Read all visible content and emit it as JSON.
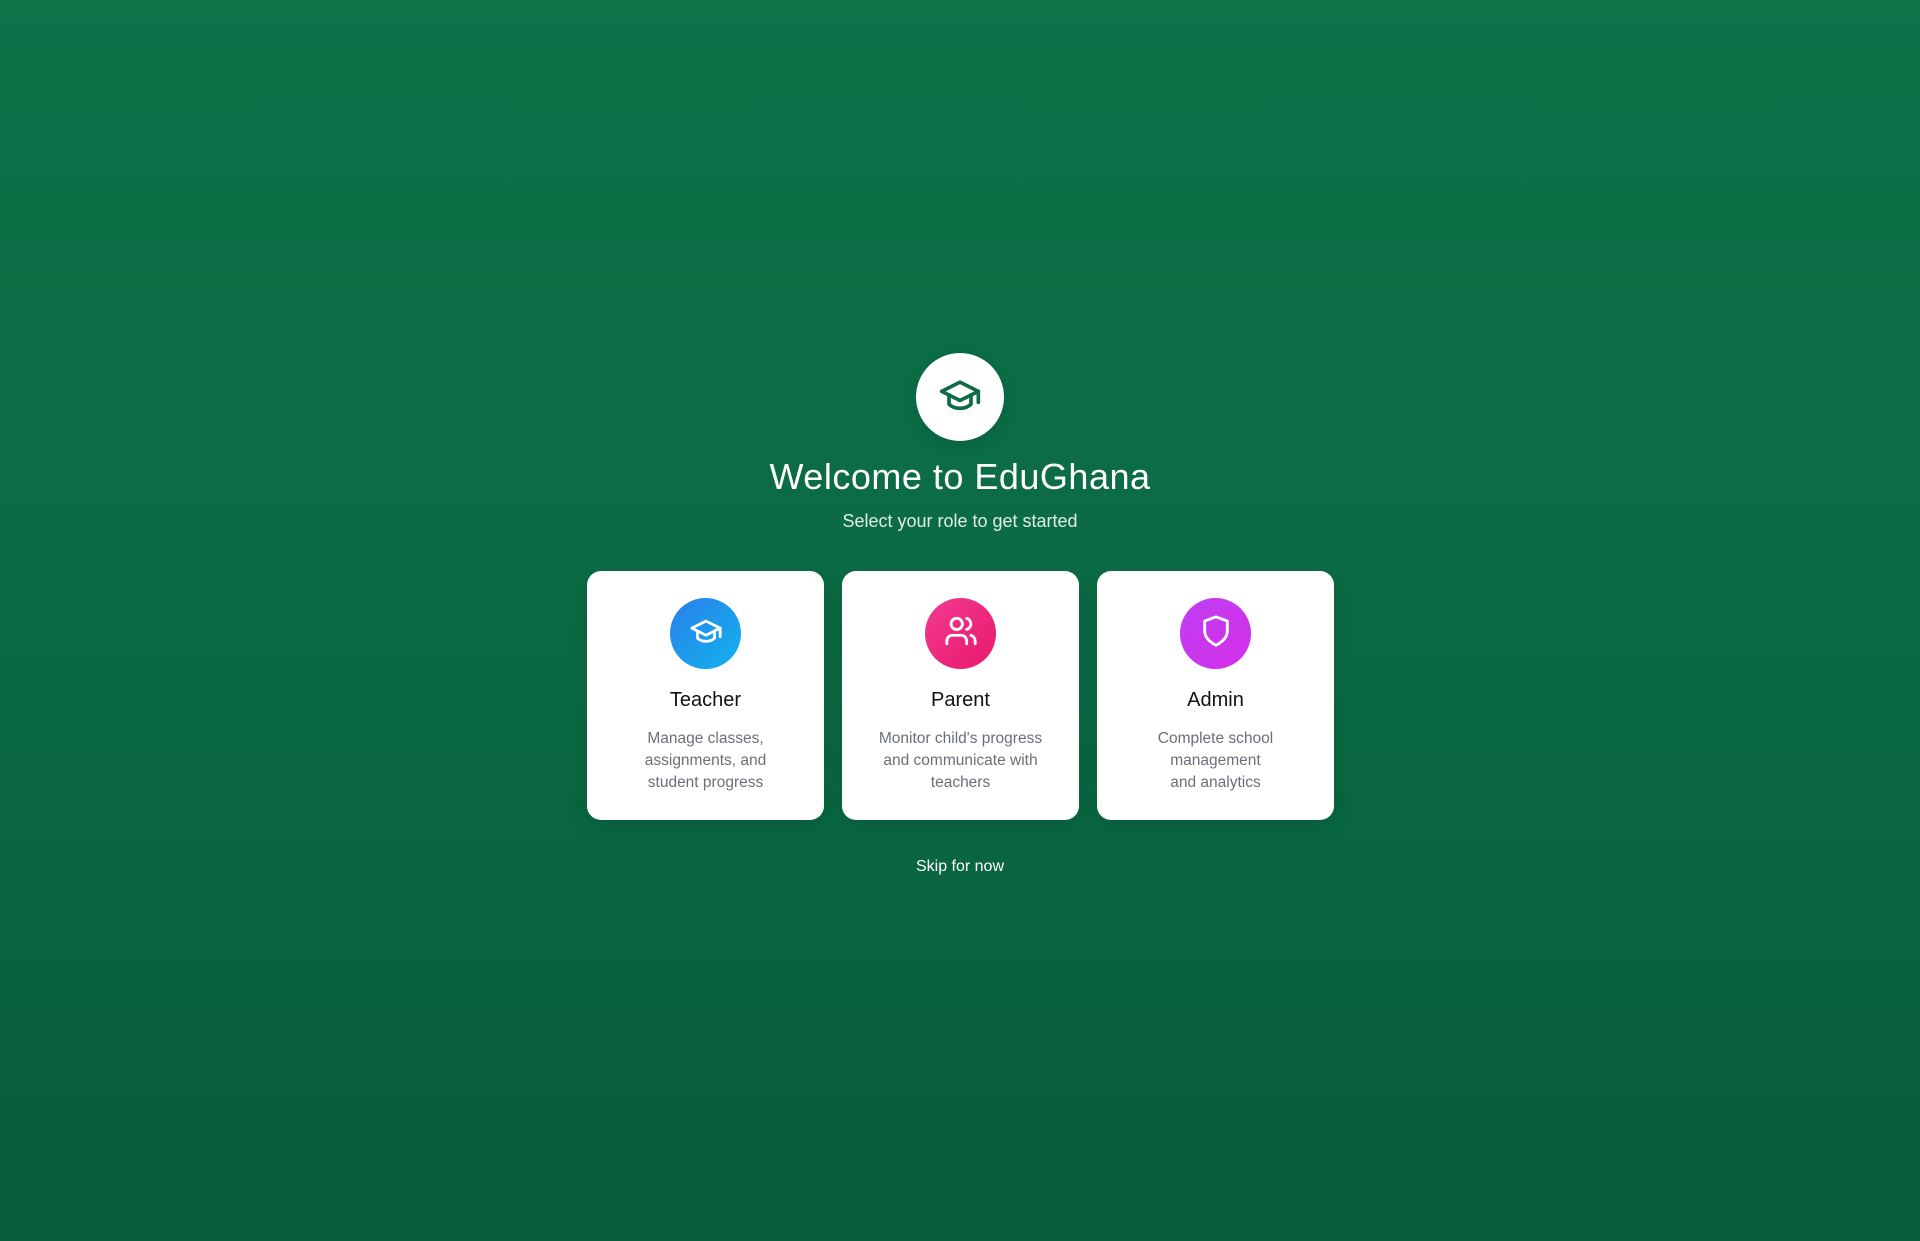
{
  "welcome": {
    "logo_icon": "graduation-cap-icon",
    "title": "Welcome to EduGhana",
    "subtitle": "Select your role to get started"
  },
  "roles": [
    {
      "icon": "graduation-cap-icon",
      "color": "#1a9aee",
      "title": "Teacher",
      "description_lines": [
        "Manage classes,",
        "assignments, and",
        "student progress"
      ]
    },
    {
      "icon": "users-icon",
      "color": "#ee2a80",
      "title": "Parent",
      "description_lines": [
        "Monitor child's progress",
        "and communicate with",
        "teachers"
      ]
    },
    {
      "icon": "shield-icon",
      "color": "#c936ee",
      "title": "Admin",
      "description_lines": [
        "Complete school",
        "management",
        "and analytics"
      ]
    }
  ],
  "skip_label": "Skip for now",
  "colors": {
    "background": "#0b6b44",
    "brand_green": "#0f6b46"
  }
}
